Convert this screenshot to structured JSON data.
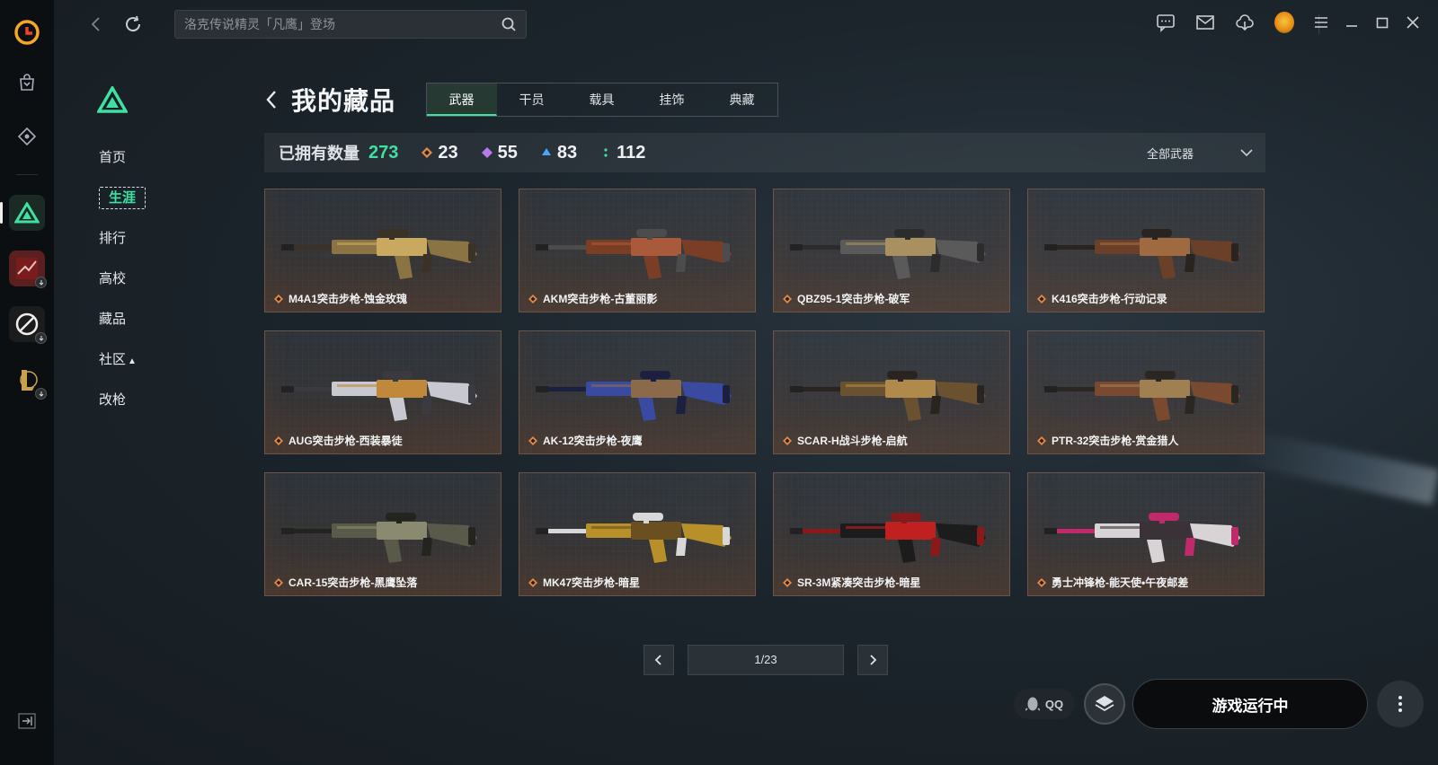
{
  "search": {
    "placeholder": "洛克传说精灵「凡鹰」登场"
  },
  "subnav": {
    "items": [
      {
        "label": "首页"
      },
      {
        "label": "生涯"
      },
      {
        "label": "排行"
      },
      {
        "label": "高校"
      },
      {
        "label": "藏品"
      },
      {
        "label": "社区"
      },
      {
        "label": "改枪"
      }
    ]
  },
  "header": {
    "title": "我的藏品"
  },
  "tabs": [
    {
      "label": "武器"
    },
    {
      "label": "干员"
    },
    {
      "label": "载具"
    },
    {
      "label": "挂饰"
    },
    {
      "label": "典藏"
    }
  ],
  "stats": {
    "owned_label": "已拥有数量",
    "owned_count": "273",
    "rarities": [
      {
        "color": "#e28a4a",
        "count": "23"
      },
      {
        "color": "#b67be8",
        "count": "55"
      },
      {
        "color": "#4aa6ff",
        "count": "83"
      },
      {
        "color": "#3fe0a1",
        "count": "112"
      }
    ],
    "filter_label": "全部武器"
  },
  "items": [
    {
      "name": "M4A1突击步枪-蚀金玫瑰",
      "palette": [
        "#8a7444",
        "#3a3226",
        "#c9a860"
      ]
    },
    {
      "name": "AKM突击步枪-古董丽影",
      "palette": [
        "#7a3e26",
        "#4c4c4c",
        "#a85a3a"
      ]
    },
    {
      "name": "QBZ95-1突击步枪-破军",
      "palette": [
        "#5a5a5a",
        "#2c2c2c",
        "#a89060"
      ]
    },
    {
      "name": "K416突击步枪-行动记录",
      "palette": [
        "#6a4028",
        "#2a2420",
        "#a06a40"
      ]
    },
    {
      "name": "AUG突击步枪-西装暴徒",
      "palette": [
        "#c8c8d0",
        "#3a3a40",
        "#c0883a"
      ]
    },
    {
      "name": "AK-12突击步枪-夜鹰",
      "palette": [
        "#3a4aa0",
        "#1c2040",
        "#8a6a4a"
      ]
    },
    {
      "name": "SCAR-H战斗步枪-启航",
      "palette": [
        "#6a5230",
        "#2a2420",
        "#b08a4a"
      ]
    },
    {
      "name": "PTR-32突击步枪-赏金猎人",
      "palette": [
        "#7a4a30",
        "#2a2622",
        "#a08050"
      ]
    },
    {
      "name": "CAR-15突击步枪-黑鹰坠落",
      "palette": [
        "#5a5a4a",
        "#24241e",
        "#8a8a70"
      ]
    },
    {
      "name": "MK47突击步枪-暗星",
      "palette": [
        "#b8902a",
        "#d8d8d8",
        "#6a5020"
      ]
    },
    {
      "name": "SR-3M紧凑突击步枪-暗星",
      "palette": [
        "#1c1c1c",
        "#8a1a1a",
        "#c02020"
      ]
    },
    {
      "name": "勇士冲锋枪-能天使•午夜邮差",
      "palette": [
        "#d8d4d6",
        "#c02a6a",
        "#3a3236"
      ]
    }
  ],
  "pager": {
    "page": "1/23"
  },
  "bottom": {
    "qq_label": "QQ",
    "launch_label": "游戏运行中"
  }
}
